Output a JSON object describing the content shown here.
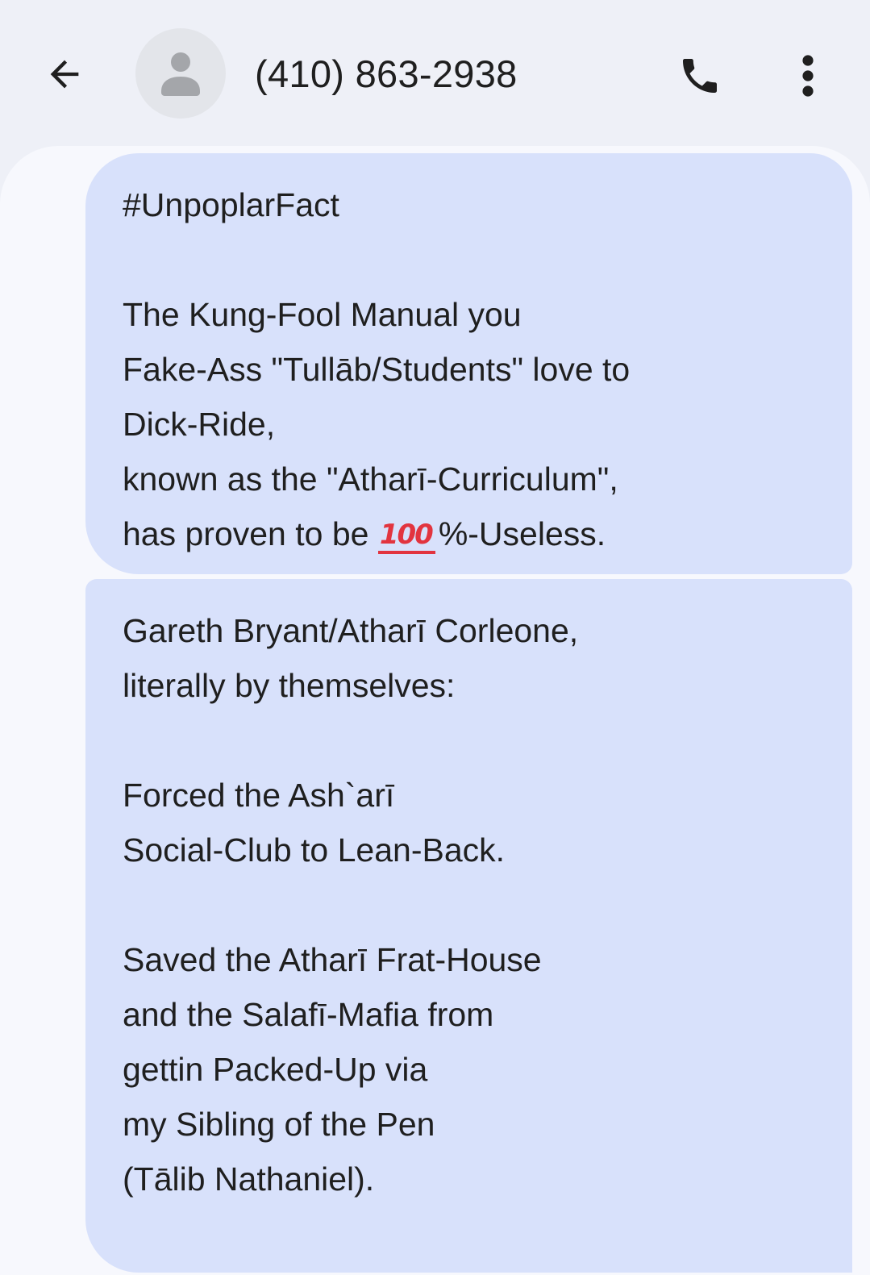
{
  "header": {
    "contact": "(410) 863-2938",
    "icons": {
      "back": "arrow-left-icon",
      "avatar": "person-icon",
      "call": "phone-icon",
      "more": "more-vert-icon"
    }
  },
  "messages": [
    {
      "part1": "#UnpoplarFact\n\nThe Kung-Fool Manual you\nFake-Ass \"Tullāb/Students\" love to\nDick-Ride,\nknown as the \"Atharī-Curriculum\",\nhas proven to be ",
      "emoji": "100",
      "part2": "%-Useless."
    },
    {
      "text": "Gareth Bryant/Atharī Corleone,\nliterally by themselves:\n\nForced the Ash`arī\nSocial-Club to Lean-Back.\n\nSaved the Atharī Frat-House\nand the Salafī-Mafia from\ngettin Packed-Up via\nmy Sibling of the Pen\n(Tālib Nathaniel)."
    }
  ],
  "colors": {
    "background": "#eef0f7",
    "thread": "#f7f8fd",
    "bubble": "#d8e1fb",
    "text": "#1f1f1f",
    "icon": "#1f1f1f",
    "emoji": "#e2343f"
  }
}
